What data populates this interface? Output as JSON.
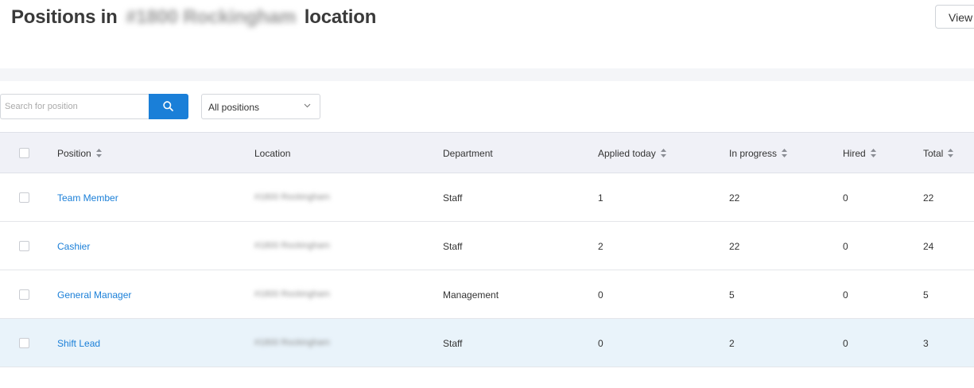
{
  "header": {
    "title_prefix": "Positions in",
    "title_location": "#1800 Rockingham",
    "title_suffix": "location",
    "view_button": "View"
  },
  "toolbar": {
    "search_placeholder": "Search for position",
    "filter_value": "All positions"
  },
  "table": {
    "columns": {
      "position": "Position",
      "location": "Location",
      "department": "Department",
      "applied_today": "Applied today",
      "in_progress": "In progress",
      "hired": "Hired",
      "total": "Total"
    },
    "rows": [
      {
        "position": "Team Member",
        "location": "#1800 Rockingham",
        "department": "Staff",
        "applied_today": "1",
        "in_progress": "22",
        "hired": "0",
        "total": "22"
      },
      {
        "position": "Cashier",
        "location": "#1800 Rockingham",
        "department": "Staff",
        "applied_today": "2",
        "in_progress": "22",
        "hired": "0",
        "total": "24"
      },
      {
        "position": "General Manager",
        "location": "#1800 Rockingham",
        "department": "Management",
        "applied_today": "0",
        "in_progress": "5",
        "hired": "0",
        "total": "5"
      },
      {
        "position": "Shift Lead",
        "location": "#1800 Rockingham",
        "department": "Staff",
        "applied_today": "0",
        "in_progress": "2",
        "hired": "0",
        "total": "3"
      }
    ]
  },
  "icons": {
    "search": "search-icon",
    "chevron": "chevron-down-icon",
    "sort": "sort-icon"
  },
  "colors": {
    "accent": "#1a7fd8",
    "header_bg": "#f0f1f7",
    "selected_row_bg": "#e9f3fa"
  }
}
